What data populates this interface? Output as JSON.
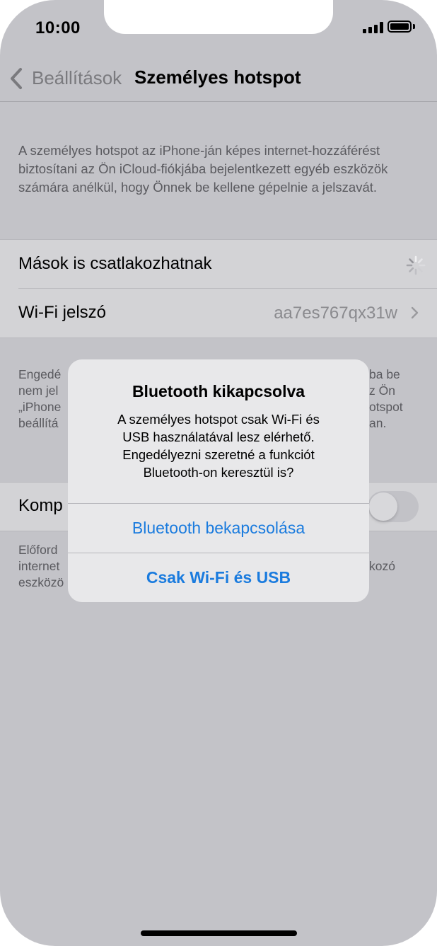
{
  "status_bar": {
    "time": "10:00"
  },
  "nav": {
    "back_label": "Beállítások",
    "title": "Személyes hotspot"
  },
  "description": "A személyes hotspot az iPhone-ján képes internet-hozzáférést biztosítani az Ön iCloud-fiókjába bejelentkezett egyéb eszközök számára anélkül, hogy Önnek be kellene gépelnie a jelszavát.",
  "settings": {
    "allow_others_label": "Mások is csatlakozhatnak",
    "wifi_password_label": "Wi-Fi jelszó",
    "wifi_password_value": "aa7es767qx31w"
  },
  "background_text": {
    "left_lines": [
      "Engedé",
      "nem jel",
      "„iPhone",
      "beállítá"
    ],
    "right_lines": [
      "ba be",
      "z Ön",
      "otspot",
      "an."
    ],
    "compat_label": "Komp",
    "footer_left_lines": [
      "Előford",
      "internet",
      "eszközö"
    ],
    "footer_right": "kozó"
  },
  "toggle": {
    "enabled": false
  },
  "alert": {
    "title": "Bluetooth kikapcsolva",
    "message_lines": [
      "A személyes hotspot csak Wi-Fi és",
      "USB használatával lesz elérhető.",
      "Engedélyezni szeretné a funkciót",
      "Bluetooth-on keresztül is?"
    ],
    "primary_button": "Bluetooth bekapcsolása",
    "secondary_button": "Csak Wi-Fi és USB"
  },
  "colors": {
    "accent": "#1a7bde",
    "dim_background": "#c3c3c8"
  },
  "icons": {
    "back": "chevron-left-icon",
    "spinner": "activity-spinner-icon",
    "chevron": "chevron-right-icon"
  }
}
